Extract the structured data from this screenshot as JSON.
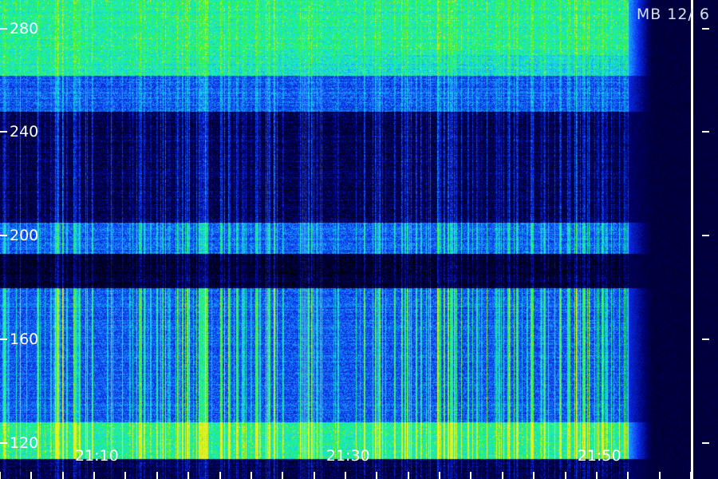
{
  "header": {
    "label": "MB  12/  6"
  },
  "chart_data": {
    "type": "heatmap",
    "title": "",
    "xlabel": "",
    "ylabel": "",
    "y_ticks": [
      "280",
      "240",
      "200",
      "160",
      "120"
    ],
    "y_tick_values": [
      280,
      240,
      200,
      160,
      120
    ],
    "ylim": [
      106,
      291
    ],
    "x_ticks": [
      "21:10",
      "21:30",
      "21:50"
    ],
    "x_tick_values": [
      "21:10",
      "21:30",
      "21:50"
    ],
    "xlim": [
      "21:02",
      "21:57"
    ],
    "grid": false,
    "bands": [
      {
        "range": [
          262,
          291
        ],
        "intensity": "high",
        "color": "#18f07a"
      },
      {
        "range": [
          248,
          262
        ],
        "intensity": "medium",
        "color": "#1830e0"
      },
      {
        "range": [
          205,
          248
        ],
        "intensity": "low",
        "color": "#000028"
      },
      {
        "range": [
          193,
          205
        ],
        "intensity": "medium",
        "color": "#2a8cff"
      },
      {
        "range": [
          180,
          193
        ],
        "intensity": "very-low",
        "color": "#000010"
      },
      {
        "range": [
          128,
          180
        ],
        "intensity": "medium",
        "color": "#1a3adf"
      },
      {
        "range": [
          114,
          128
        ],
        "intensity": "high",
        "color": "#6af020"
      },
      {
        "range": [
          106,
          114
        ],
        "intensity": "low",
        "color": "#0c1a80"
      }
    ],
    "signal_end_time": "21:52",
    "colormap": [
      "#000008",
      "#00006a",
      "#0a2ae8",
      "#1a9cff",
      "#18f0c8",
      "#30f040",
      "#e8f020"
    ]
  }
}
